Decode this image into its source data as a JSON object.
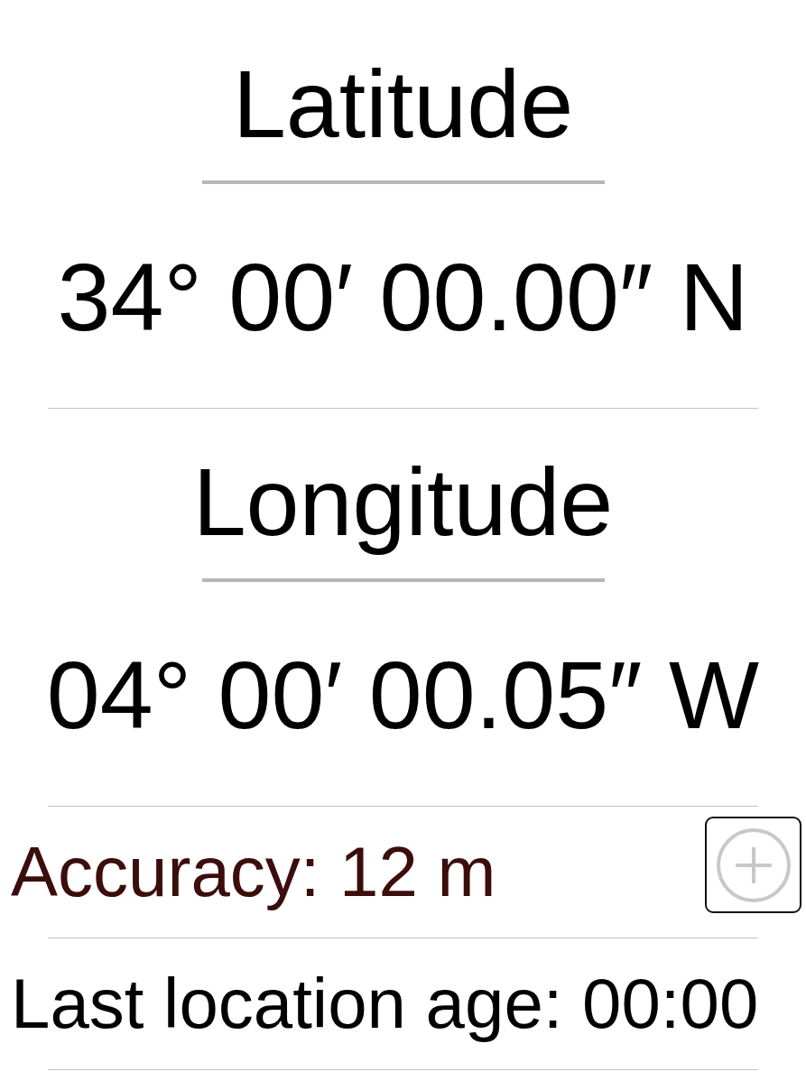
{
  "coordinates": [
    {
      "label": "Latitude",
      "value": "34° 00′ 00.00″ N"
    },
    {
      "label": "Longitude",
      "value": "04° 00′ 00.05″ W"
    }
  ],
  "accuracy": {
    "text": "Accuracy: 12 m"
  },
  "last_location_age": {
    "text": "Last location age: 00:00"
  }
}
